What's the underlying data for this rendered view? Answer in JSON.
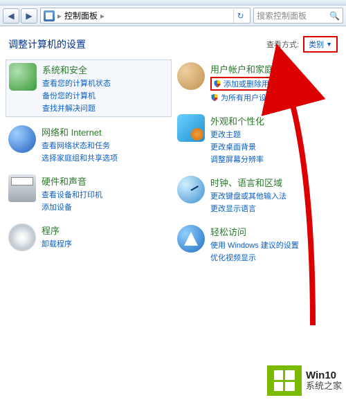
{
  "toolbar": {
    "breadcrumb": "控制面板",
    "separator": "▸",
    "search_placeholder": "搜索控制面板"
  },
  "header": {
    "title": "调整计算机的设置",
    "view_label": "查看方式:",
    "view_value": "类别"
  },
  "cats": {
    "left": [
      {
        "title": "系统和安全",
        "links": [
          "查看您的计算机状态",
          "备份您的计算机",
          "查找并解决问题"
        ]
      },
      {
        "title": "网络和 Internet",
        "links": [
          "查看网络状态和任务",
          "选择家庭组和共享选项"
        ]
      },
      {
        "title": "硬件和声音",
        "links": [
          "查看设备和打印机",
          "添加设备"
        ]
      },
      {
        "title": "程序",
        "links": [
          "卸载程序"
        ]
      }
    ],
    "right": [
      {
        "title": "用户帐户和家庭安全",
        "links": [
          "添加或删除用户帐户",
          "为所有用户设置家长控制"
        ],
        "shielded": true,
        "hl": 0
      },
      {
        "title": "外观和个性化",
        "links": [
          "更改主题",
          "更改桌面背景",
          "调整屏幕分辨率"
        ]
      },
      {
        "title": "时钟、语言和区域",
        "links": [
          "更改键盘或其他输入法",
          "更改显示语言"
        ]
      },
      {
        "title": "轻松访问",
        "links": [
          "使用 Windows 建议的设置",
          "优化视频显示"
        ]
      }
    ]
  },
  "watermark": {
    "line1": "Win10",
    "line2": "系统之家"
  }
}
